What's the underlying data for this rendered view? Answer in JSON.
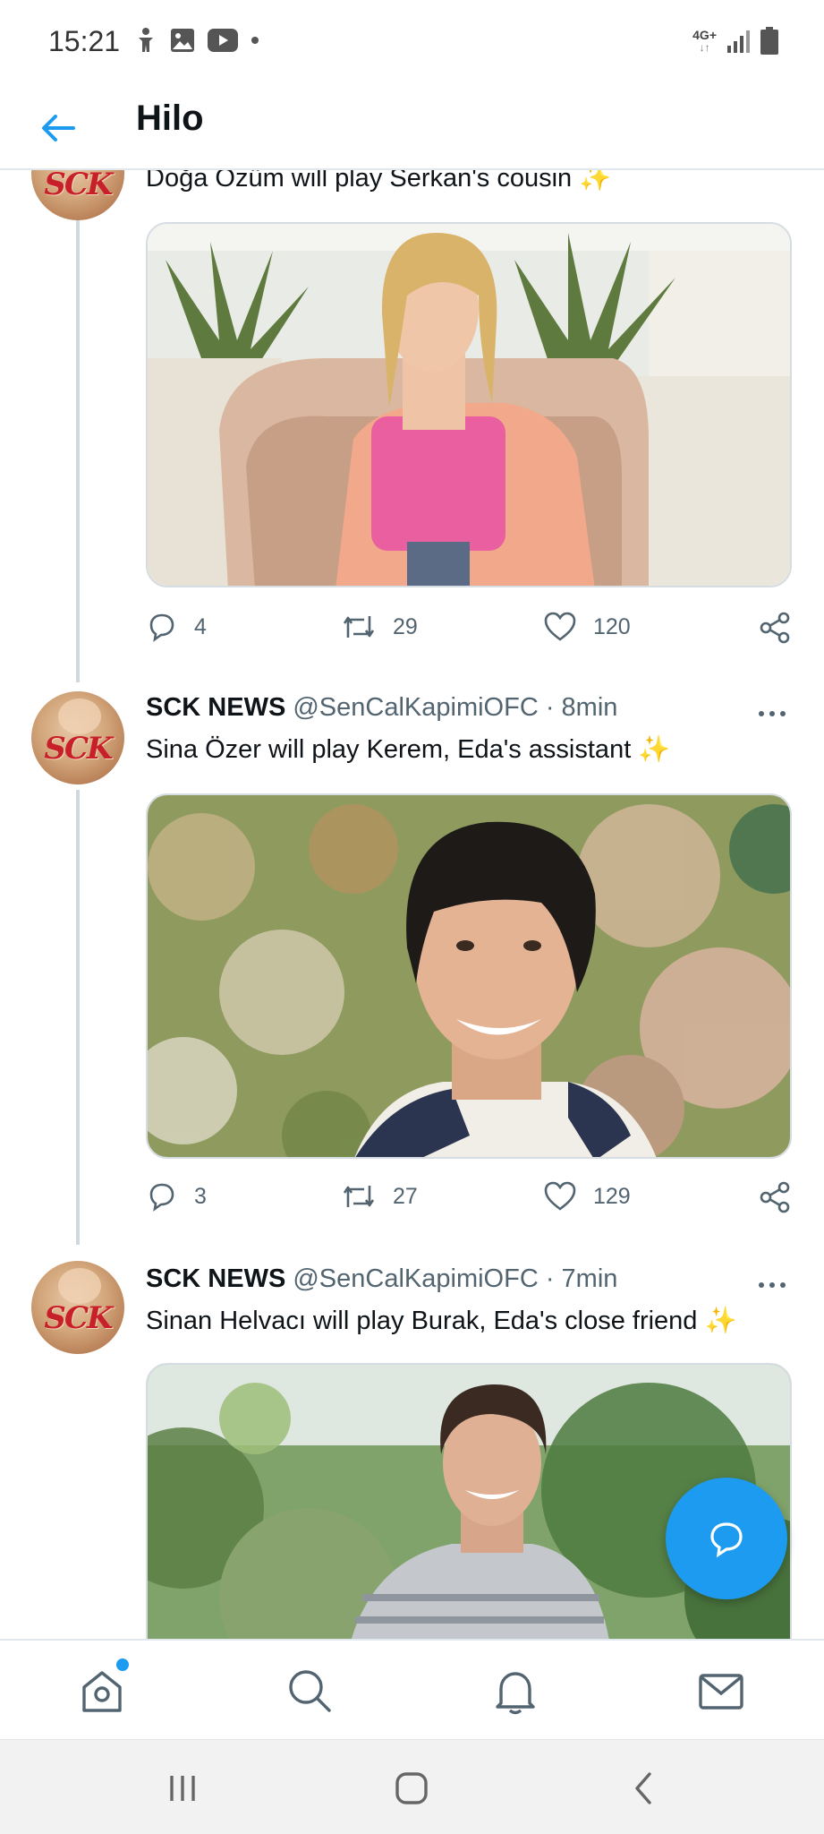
{
  "status_bar": {
    "time": "15:21",
    "network_label": "4G+",
    "left_icons": [
      "accessibility-icon",
      "gallery-icon",
      "youtube-icon",
      "dot-icon"
    ],
    "right_icons": [
      "signal-icon",
      "battery-icon"
    ]
  },
  "header": {
    "title": "Hilo",
    "back_icon": "arrow-left-icon"
  },
  "tweets": [
    {
      "text": "Doğa Özüm will play Serkan's cousin",
      "emoji": "✨",
      "stats": {
        "replies": "4",
        "retweets": "29",
        "likes": "120"
      }
    },
    {
      "name": "SCK NEWS",
      "handle": "@SenCalKapimiOFC",
      "time": "· 8min",
      "text": "Sina Özer will play Kerem, Eda's assistant",
      "emoji": "✨",
      "stats": {
        "replies": "3",
        "retweets": "27",
        "likes": "129"
      }
    },
    {
      "name": "SCK NEWS",
      "handle": "@SenCalKapimiOFC",
      "time": "· 7min",
      "text": "Sinan Helvacı will play Burak, Eda's close friend",
      "emoji": "✨"
    }
  ],
  "avatar_text": "SCK",
  "bottom_nav": {
    "items": [
      "home-icon",
      "search-icon",
      "bell-icon",
      "mail-icon"
    ]
  },
  "system_nav": [
    "recents-icon",
    "home-circle-icon",
    "back-chevron-icon"
  ],
  "colors": {
    "accent": "#1d9bf0",
    "text": "#0f1419",
    "secondary": "#536471",
    "border": "#cfd9de"
  }
}
